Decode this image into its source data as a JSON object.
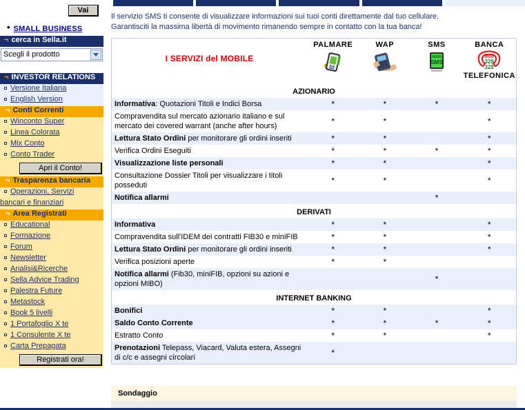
{
  "sidebar": {
    "go_button": "Vai",
    "small_business": "SMALL BUSINESS",
    "search_header": "cerca in Sella.it",
    "product_select_value": "Scegli il prodotto",
    "investor_relations_header": "INVESTOR RELATIONS",
    "links_top": [
      {
        "label": "Versione Italiana"
      },
      {
        "label": "English Version "
      }
    ],
    "section_conti": "Conti Correnti",
    "conti_links": [
      {
        "label": "Winconto Super"
      },
      {
        "label": "Linea Colorata"
      },
      {
        "label": "Mix Conto"
      },
      {
        "label": "Conto Trader"
      }
    ],
    "apri_conto_button": "Apri il Conto!",
    "section_trasparenza": "Trasparenza bancaria",
    "trasparenza_links": [
      {
        "label": "Operazioni, Servizi"
      },
      {
        "label": "bancari e finanziari"
      }
    ],
    "section_area": "Area Registrati",
    "area_links": [
      {
        "label": "Educational"
      },
      {
        "label": "Formazione"
      },
      {
        "label": "Forum"
      },
      {
        "label": "Newsletter"
      },
      {
        "label": "Analisi&Ricerche"
      },
      {
        "label": "Sella Advice Trading"
      },
      {
        "label": "Palestra Future"
      },
      {
        "label": "Metastock"
      },
      {
        "label": "Book 5 livelli"
      },
      {
        "label": "1 Portafoglio X te"
      },
      {
        "label": "1 Consulente X te"
      },
      {
        "label": "Carta Prepagata"
      }
    ],
    "registrati_button": "Registrati ora!"
  },
  "main": {
    "intro_line1": "Il servizio SMS ti consente di visualizzare informazioni sui tuoi conti direttamente dal tuo cellulare.",
    "intro_line2": "Garantisciti la massima libertà di movimento rimanendo sempre in contatto con la tua banca!",
    "table_title": "I SERVIZI del MOBILE",
    "columns": [
      {
        "label": "PALMARE",
        "icon": "pda-icon"
      },
      {
        "label": "WAP",
        "icon": "mobile-phone-icon"
      },
      {
        "label": "SMS",
        "icon": "sms-phone-icon"
      },
      {
        "label": "BANCA",
        "label2": "TELEFONICA",
        "icon": "telephone-number-icon",
        "number_lines": [
          "800",
          "328",
          "328"
        ]
      }
    ],
    "mark": "*",
    "sections": [
      {
        "title": "AZIONARIO",
        "rows": [
          {
            "bold": "Informativa",
            "rest": ": Quotazioni Titoli e Indici Borsa",
            "marks": [
              true,
              true,
              true,
              true
            ]
          },
          {
            "bold": "",
            "rest": "Compravendita sul mercato azionario italiano e sul mercato dei covered warrant (anche after hours)",
            "marks": [
              true,
              true,
              false,
              true
            ]
          },
          {
            "bold": "Lettura Stato Ordini",
            "rest": " per monitorare gli ordini inseriti",
            "marks": [
              true,
              true,
              false,
              true
            ]
          },
          {
            "bold": "",
            "rest": "Verifica Ordini Eseguiti",
            "marks": [
              true,
              true,
              true,
              true
            ]
          },
          {
            "bold": "Visualizzazione liste personali",
            "rest": "",
            "marks": [
              true,
              true,
              false,
              true
            ]
          },
          {
            "bold": "",
            "rest": "Consultazione Dossier Titoli per visualizzare i titoli posseduti",
            "marks": [
              true,
              true,
              false,
              true
            ]
          },
          {
            "bold": "Notifica allarmi",
            "rest": "",
            "marks": [
              false,
              false,
              true,
              false
            ]
          }
        ]
      },
      {
        "title": "DERIVATI",
        "rows": [
          {
            "bold": "Informativa",
            "rest": "",
            "marks": [
              true,
              true,
              false,
              true
            ]
          },
          {
            "bold": "",
            "rest": "Compravendita sull'IDEM dei contratti FIB30 e miniFIB",
            "marks": [
              true,
              true,
              false,
              true
            ]
          },
          {
            "bold": "Lettura Stato Ordini",
            "rest": " per monitorare gli ordini inseriti",
            "marks": [
              true,
              true,
              false,
              true
            ]
          },
          {
            "bold": "",
            "rest": "Verifica posizioni aperte",
            "marks": [
              true,
              true,
              false,
              false
            ]
          },
          {
            "bold": "Notifica allarmi",
            "rest": " (Fib30, miniFIB, opzioni su azioni e opzioni MIBO)",
            "marks": [
              false,
              false,
              true,
              false
            ]
          }
        ]
      },
      {
        "title": "INTERNET BANKING",
        "rows": [
          {
            "bold": "Bonifici",
            "rest": "",
            "marks": [
              true,
              true,
              false,
              true
            ]
          },
          {
            "bold": "Saldo Conto Corrente",
            "rest": "",
            "marks": [
              true,
              true,
              true,
              true
            ]
          },
          {
            "bold": "",
            "rest": "Estratto Conto",
            "marks": [
              true,
              true,
              false,
              true
            ]
          },
          {
            "bold": "Prenotazioni",
            "rest": " Telepass, Viacard, Valuta estera, Assegni di c/c e assegni circolari",
            "marks": [
              true,
              false,
              false,
              false
            ]
          }
        ]
      }
    ],
    "sondaggio_title": "Sondaggio"
  },
  "colors": {
    "navy": "#1b2f6b",
    "amber": "#f5a800",
    "light_yellow": "#ffe9a8",
    "row_alt": "#eaf0fb",
    "title_red": "#d00000"
  }
}
